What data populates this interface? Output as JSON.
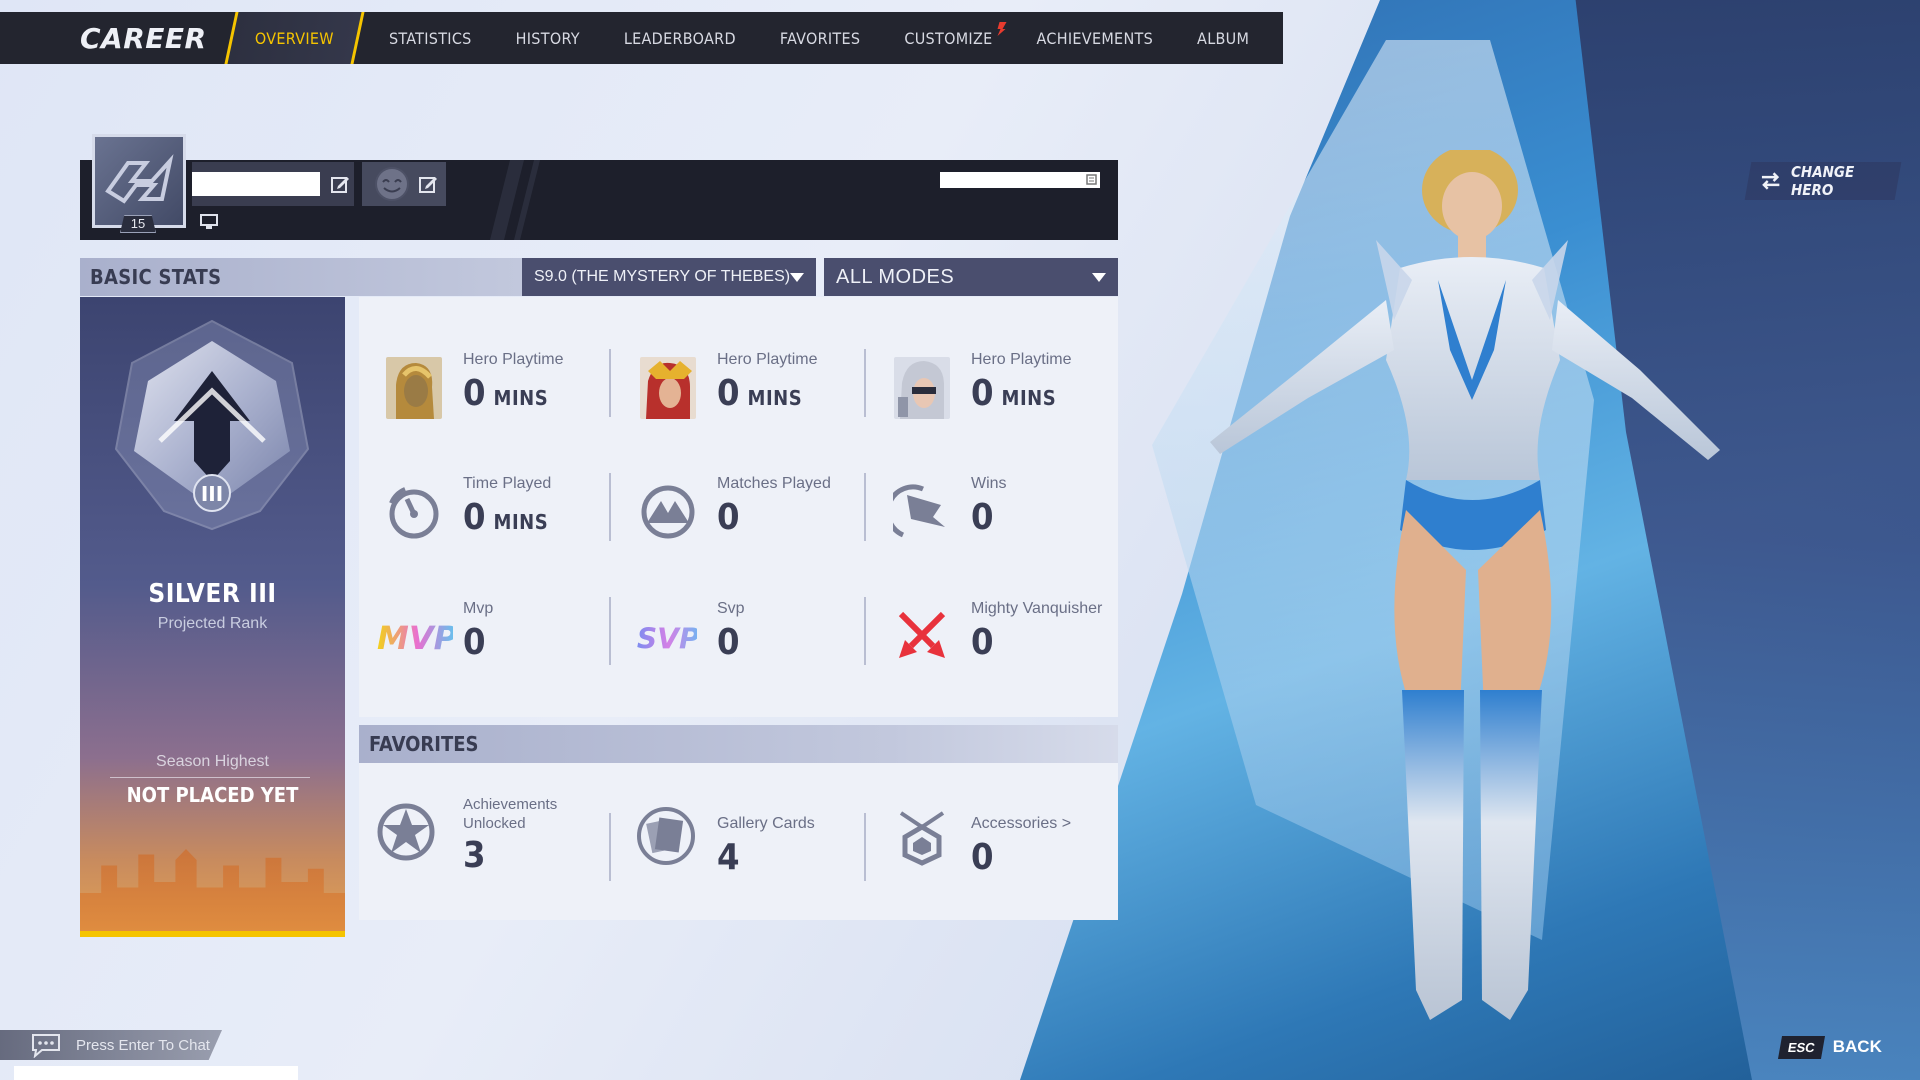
{
  "nav": {
    "title": "CAREER",
    "tabs": [
      {
        "label": "OVERVIEW",
        "active": true
      },
      {
        "label": "STATISTICS"
      },
      {
        "label": "HISTORY"
      },
      {
        "label": "LEADERBOARD"
      },
      {
        "label": "FAVORITES"
      },
      {
        "label": "CUSTOMIZE",
        "new_flag": true
      },
      {
        "label": "ACHIEVEMENTS"
      },
      {
        "label": "ALBUM"
      }
    ]
  },
  "profile": {
    "level": "15"
  },
  "basic_stats": {
    "header": "BASIC STATS",
    "season": "S9.0 (THE MYSTERY OF THEBES)",
    "mode": "ALL MODES"
  },
  "rank": {
    "name": "SILVER III",
    "subtitle": "Projected Rank",
    "season_highest_label": "Season Highest",
    "season_highest_value": "NOT PLACED YET"
  },
  "stats": [
    {
      "label": "Hero Playtime",
      "value": "0",
      "unit": "MINS",
      "icon": "hero-portrait-1"
    },
    {
      "label": "Hero Playtime",
      "value": "0",
      "unit": "MINS",
      "icon": "hero-portrait-2"
    },
    {
      "label": "Hero Playtime",
      "value": "0",
      "unit": "MINS",
      "icon": "hero-portrait-3"
    },
    {
      "label": "Time Played",
      "value": "0",
      "unit": "MINS",
      "icon": "stopwatch-icon"
    },
    {
      "label": "Matches Played",
      "value": "0",
      "unit": "",
      "icon": "matches-icon"
    },
    {
      "label": "Wins",
      "value": "0",
      "unit": "",
      "icon": "flag-icon"
    },
    {
      "label": "Mvp",
      "value": "0",
      "unit": "",
      "icon": "mvp-icon"
    },
    {
      "label": "Svp",
      "value": "0",
      "unit": "",
      "icon": "svp-icon"
    },
    {
      "label": "Mighty Vanquisher",
      "value": "0",
      "unit": "",
      "icon": "crossed-swords-icon"
    }
  ],
  "favorites": {
    "header": "FAVORITES",
    "items": [
      {
        "label": "Achievements\nUnlocked",
        "value": "3",
        "icon": "achievement-star-icon"
      },
      {
        "label": "Gallery Cards",
        "value": "4",
        "icon": "gallery-cards-icon"
      },
      {
        "label": "Accessories >",
        "value": "0",
        "icon": "accessory-icon"
      }
    ]
  },
  "change_hero": "CHANGE HERO",
  "chat": {
    "label": "Press Enter To Chat"
  },
  "back": {
    "key": "ESC",
    "label": "BACK"
  },
  "colors": {
    "accent": "#f5c400",
    "nav_bg": "#23252f",
    "panel_bg": "#eef1f8"
  }
}
